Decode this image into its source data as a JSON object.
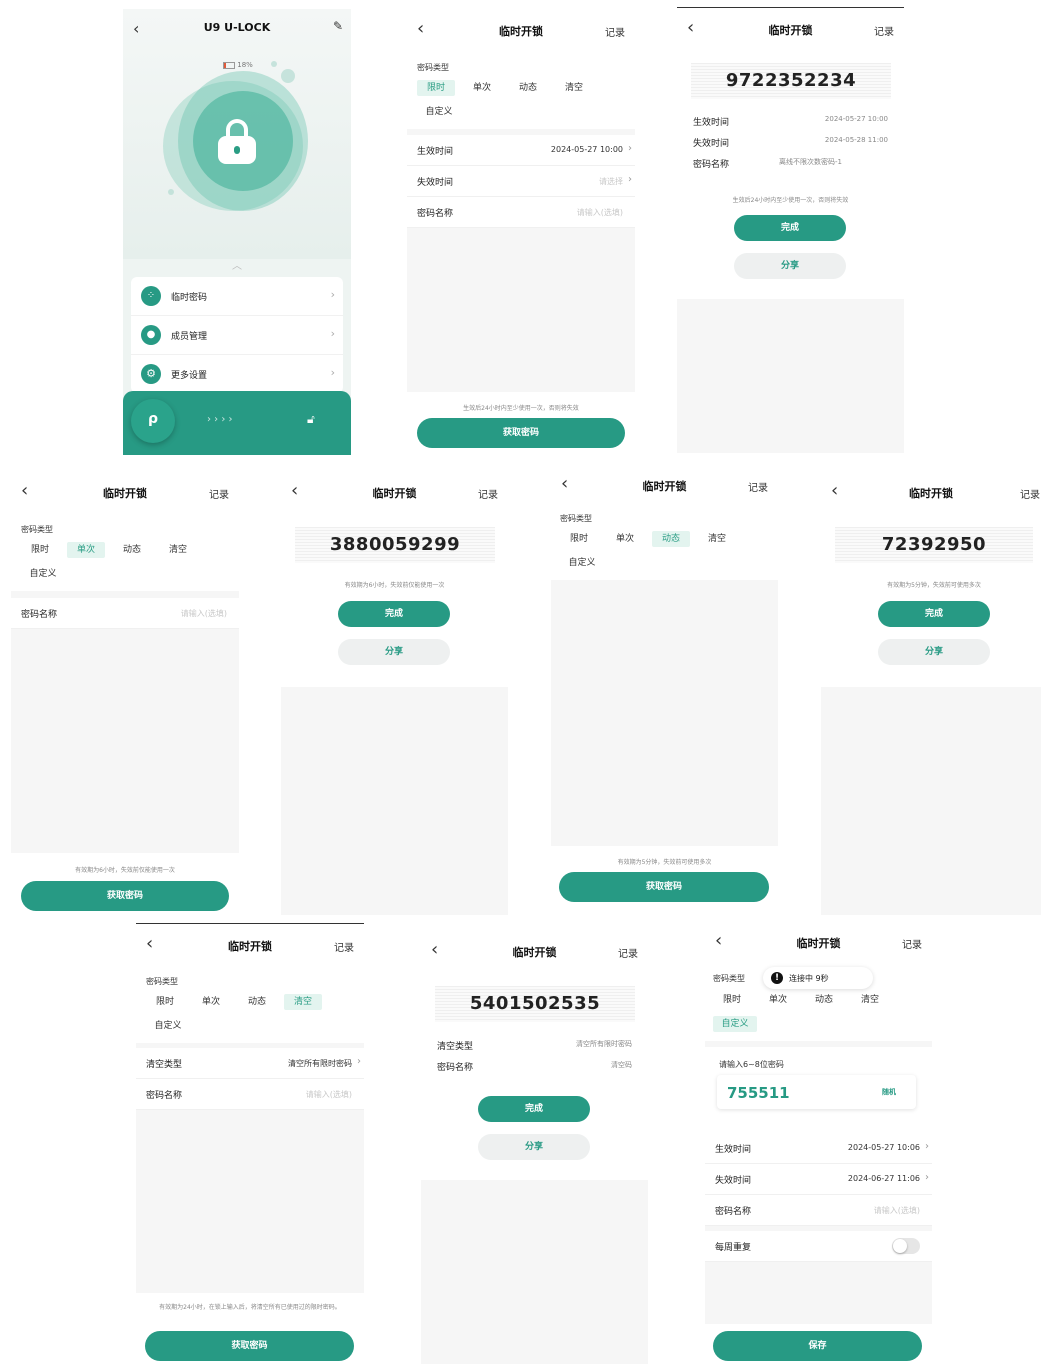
{
  "home": {
    "title": "U9 U-LOCK",
    "battery": "18%",
    "menu": [
      {
        "label": "临时密码",
        "icon": "grid-icon"
      },
      {
        "label": "成员管理",
        "icon": "user-icon"
      },
      {
        "label": "更多设置",
        "icon": "gear-icon"
      }
    ],
    "slide_arrows": "› › › ›"
  },
  "common": {
    "title": "临时开锁",
    "record": "记录",
    "pwd_type": "密码类型",
    "types": [
      "限时",
      "单次",
      "动态",
      "清空"
    ],
    "custom": "自定义",
    "effective": "生效时间",
    "expire": "失效时间",
    "name": "密码名称",
    "name_ph": "请输入(选填)",
    "select_ph": "请选择",
    "get_pwd": "获取密码",
    "done": "完成",
    "share": "分享",
    "save": "保存"
  },
  "s2": {
    "effective_value": "2024-05-27 10:00",
    "note": "生效后24小时内至少使用一次，否则将失效"
  },
  "s3": {
    "code": "9722352234",
    "effective_value": "2024-05-27 10:00",
    "expire_value": "2024-05-28 11:00",
    "name_value": "离线不限次数密码-1",
    "note": "生效后24小时内至少使用一次，否则将失效"
  },
  "s4": {
    "note": "有效期为6小时，失效前仅能使用一次"
  },
  "s5": {
    "code": "3880059299",
    "note": "有效期为6小时，失效前仅能使用一次"
  },
  "s6": {
    "note": "有效期为5分钟，失效前可使用多次"
  },
  "s7": {
    "code": "72392950",
    "note": "有效期为5分钟，失效前可使用多次"
  },
  "s8": {
    "clear_type": "清空类型",
    "clear_value": "清空所有限时密码",
    "note": "有效期为24小时，在锁上输入后，将清空所有已使用过的限时密码。"
  },
  "s9": {
    "code": "5401502535",
    "clear_type": "清空类型",
    "clear_value": "清空所有限时密码",
    "name_value": "清空码"
  },
  "s10": {
    "toast": "连接中 9秒",
    "input_label": "请输入6~8位密码",
    "code": "755511",
    "random": "随机",
    "effective_value": "2024-05-27 10:06",
    "expire_value": "2024-06-27 11:06",
    "weekly": "每周重复"
  },
  "colors": {
    "accent": "#279a84",
    "chip_bg": "#e3f4ef",
    "home_bg": "#e9f4f0"
  }
}
